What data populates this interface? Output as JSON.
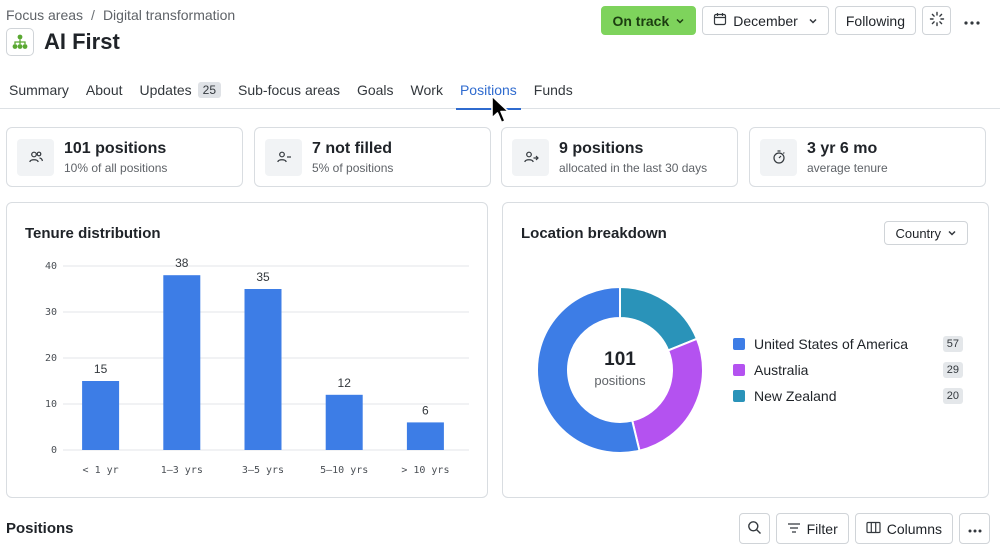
{
  "breadcrumb": {
    "parent": "Focus areas",
    "separator": "/",
    "current": "Digital transformation"
  },
  "page": {
    "title": "AI First"
  },
  "header": {
    "status_label": "On track",
    "period_label": "December",
    "follow_label": "Following"
  },
  "tabs": [
    {
      "label": "Summary"
    },
    {
      "label": "About"
    },
    {
      "label": "Updates",
      "badge": "25"
    },
    {
      "label": "Sub-focus areas"
    },
    {
      "label": "Goals"
    },
    {
      "label": "Work"
    },
    {
      "label": "Positions",
      "active": true
    },
    {
      "label": "Funds"
    }
  ],
  "stats": [
    {
      "value": "101 positions",
      "sub": "10% of all positions",
      "icon": "people-icon"
    },
    {
      "value": "7 not filled",
      "sub": "5% of positions",
      "icon": "person-minus-icon"
    },
    {
      "value": "9 positions",
      "sub": "allocated in the last 30 days",
      "icon": "person-arrow-icon"
    },
    {
      "value": "3 yr 6 mo",
      "sub": "average tenure",
      "icon": "stopwatch-icon"
    }
  ],
  "tenure": {
    "title": "Tenure distribution",
    "chart_data": {
      "type": "bar",
      "categories": [
        "< 1 yr",
        "1–3 yrs",
        "3–5 yrs",
        "5–10 yrs",
        "> 10 yrs"
      ],
      "values": [
        15,
        38,
        35,
        12,
        6
      ],
      "ylim": [
        0,
        40
      ],
      "yticks": [
        0,
        10,
        20,
        30,
        40
      ],
      "grid": true,
      "color": "#3d7de6"
    }
  },
  "location": {
    "title": "Location breakdown",
    "filter_label": "Country",
    "center_value": "101",
    "center_label": "positions",
    "chart_data": {
      "type": "pie",
      "series": [
        {
          "name": "United States of America",
          "value": 57,
          "color": "#3d7de6"
        },
        {
          "name": "Australia",
          "value": 29,
          "color": "#b452f0"
        },
        {
          "name": "New Zealand",
          "value": 20,
          "color": "#2a93b9"
        }
      ]
    }
  },
  "positions": {
    "title": "Positions",
    "filter_label": "Filter",
    "columns_label": "Columns"
  }
}
